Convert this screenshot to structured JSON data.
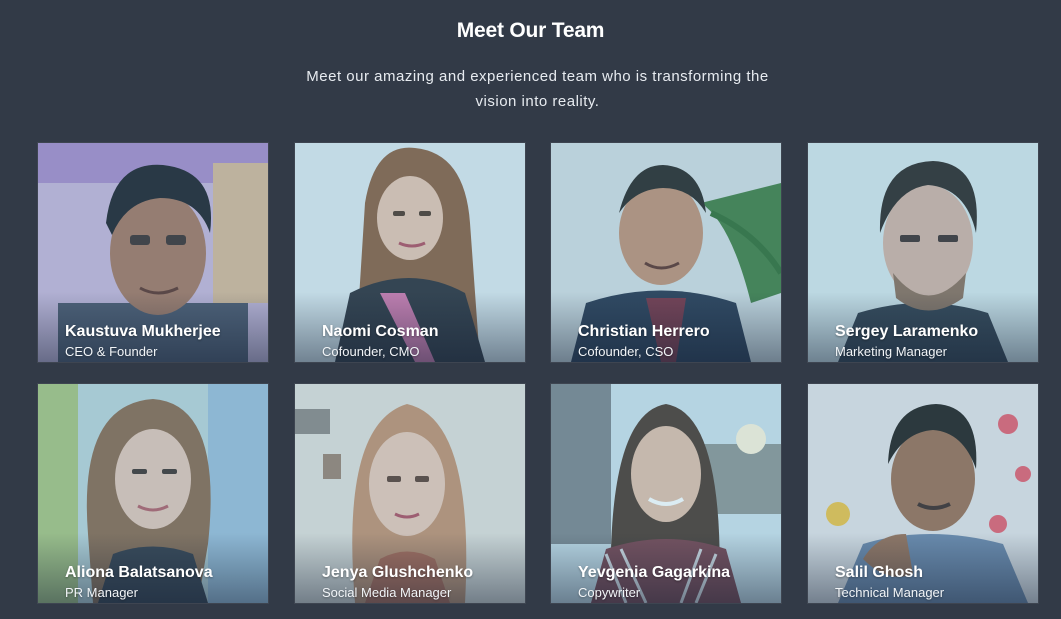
{
  "section": {
    "title": "Meet Our Team",
    "subtitle": "Meet our amazing and experienced team who is transforming the vision into reality."
  },
  "members": [
    {
      "name": "Kaustuva Mukherjee",
      "role": "CEO & Founder",
      "photo_icon": "person-photo-icon"
    },
    {
      "name": "Naomi Cosman",
      "role": "Cofounder, CMO",
      "photo_icon": "person-photo-icon"
    },
    {
      "name": "Christian Herrero",
      "role": "Cofounder, CSO",
      "photo_icon": "person-photo-icon"
    },
    {
      "name": "Sergey Laramenko",
      "role": "Marketing Manager",
      "photo_icon": "person-photo-icon"
    },
    {
      "name": "Aliona Balatsanova",
      "role": "PR Manager",
      "photo_icon": "person-photo-icon"
    },
    {
      "name": "Jenya Glushchenko",
      "role": "Social Media Manager",
      "photo_icon": "person-photo-icon"
    },
    {
      "name": "Yevgenia Gagarkina",
      "role": "Copywriter",
      "photo_icon": "person-photo-icon"
    },
    {
      "name": "Salil Ghosh",
      "role": "Technical Manager",
      "photo_icon": "person-photo-icon"
    }
  ],
  "colors": {
    "background": "#323a47",
    "text": "#ffffff",
    "photo_tint": "#5aaac8"
  }
}
